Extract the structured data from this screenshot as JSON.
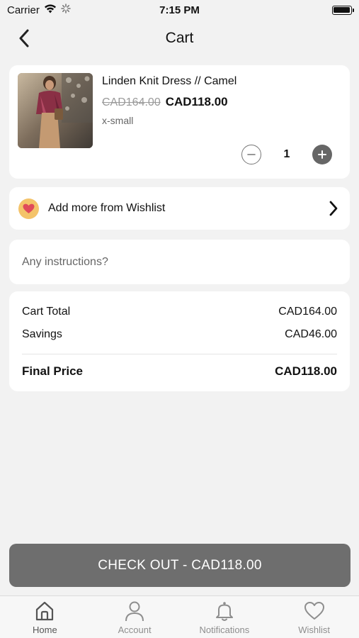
{
  "status_bar": {
    "carrier": "Carrier",
    "time": "7:15 PM",
    "icons": [
      "wifi-icon",
      "activity-icon",
      "battery-icon"
    ]
  },
  "nav": {
    "title": "Cart",
    "back_icon": "chevron-left-icon"
  },
  "cart_item": {
    "name": "Linden Knit Dress // Camel",
    "original_price": "CAD164.00",
    "sale_price": "CAD118.00",
    "variant": "x-small",
    "quantity": "1"
  },
  "wishlist_link": {
    "label": "Add more from Wishlist",
    "icon": "heart-icon",
    "accent": "#f4c36a",
    "heart_color": "#e04a5a"
  },
  "instructions": {
    "placeholder": "Any instructions?",
    "value": ""
  },
  "summary": {
    "rows": [
      {
        "label": "Cart Total",
        "value": "CAD164.00"
      },
      {
        "label": "Savings",
        "value": "CAD46.00"
      }
    ],
    "final": {
      "label": "Final Price",
      "value": "CAD118.00"
    }
  },
  "checkout": {
    "label": "CHECK OUT - CAD118.00",
    "color": "#6e6e6e"
  },
  "tabs": [
    {
      "label": "Home",
      "icon": "home-icon",
      "active": true
    },
    {
      "label": "Account",
      "icon": "user-icon",
      "active": false
    },
    {
      "label": "Notifications",
      "icon": "bell-icon",
      "active": false
    },
    {
      "label": "Wishlist",
      "icon": "heart-outline-icon",
      "active": false
    }
  ]
}
